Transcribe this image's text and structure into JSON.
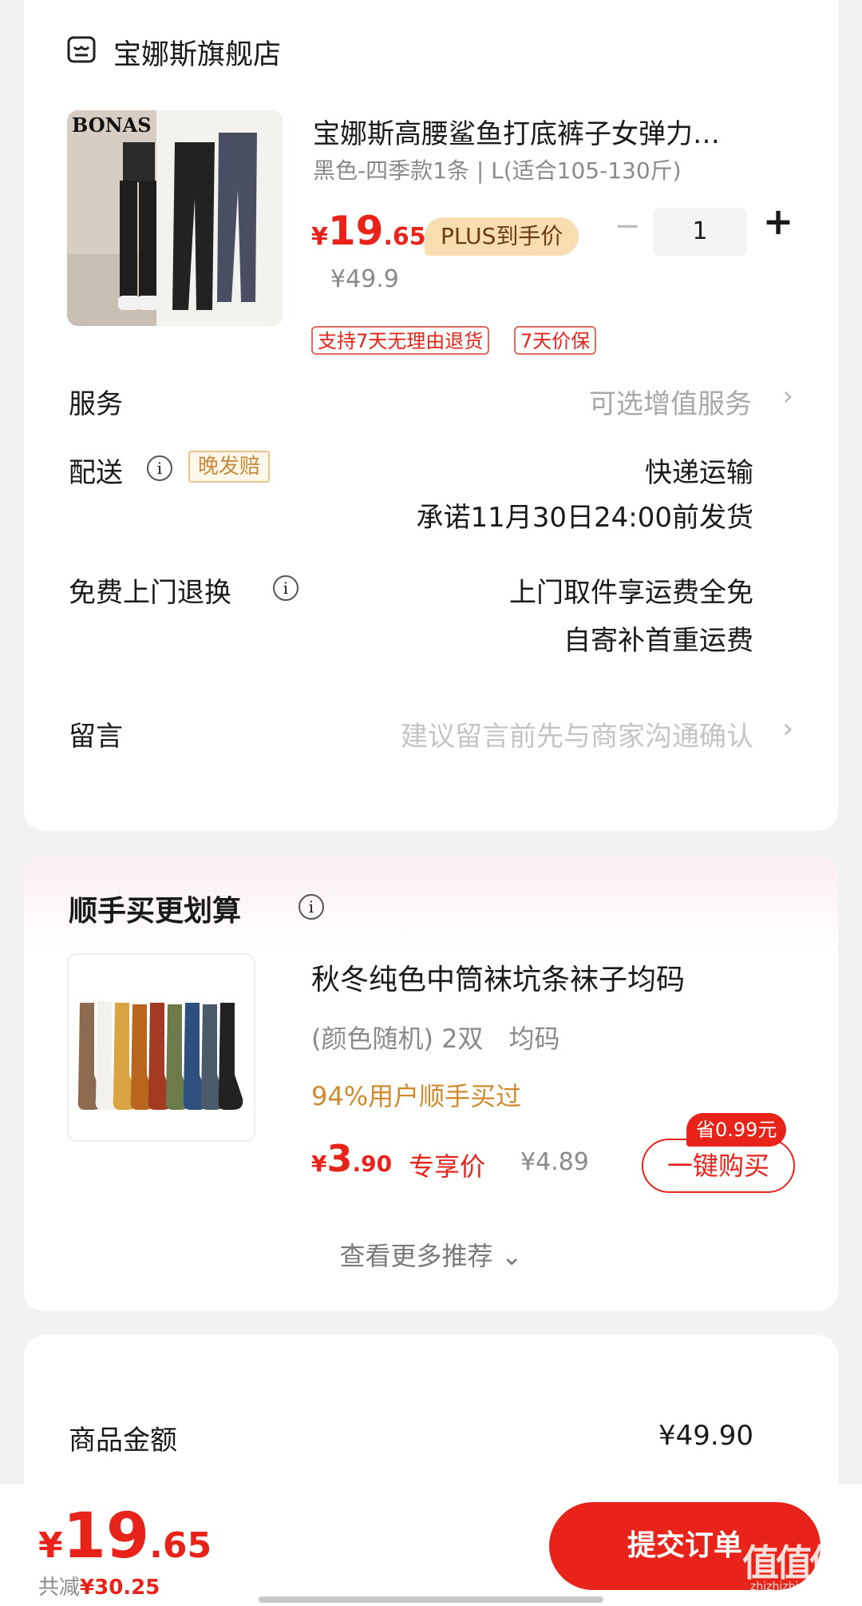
{
  "store": {
    "name": "宝娜斯旗舰店",
    "icon": "store-icon"
  },
  "product": {
    "title": "宝娜斯高腰鲨鱼打底裤子女弹力…",
    "spec": "黑色-四季款1条 | L(适合105-130斤)",
    "price_symbol": "¥",
    "price_int": "19",
    "price_dec": ".65",
    "plus_label": "PLUS到手价",
    "minus_label": "−",
    "quantity": "1",
    "plus_label_btn": "+",
    "original_price": "¥49.9",
    "tags": [
      "支持7天无理由退货",
      "7天价保"
    ],
    "image_brand": "BONAS"
  },
  "rows": {
    "service": {
      "label": "服务",
      "value": "可选增值服务",
      "chevron": "›"
    },
    "delivery": {
      "label": "配送",
      "badge": "晚发赔",
      "value_line1": "快递运输",
      "value_line2": "承诺11月30日24:00前发货"
    },
    "return": {
      "label": "免费上门退换",
      "value_line1": "上门取件享运费全免",
      "value_line2": "自寄补首重运费"
    },
    "message": {
      "label": "留言",
      "placeholder": "建议留言前先与商家沟通确认",
      "chevron": "›"
    }
  },
  "addon": {
    "section_title": "顺手买更划算",
    "title": "秋冬纯色中筒袜坑条袜子均码",
    "spec": "(颜色随机) 2双",
    "size": "均码",
    "hint": "94%用户顺手买过",
    "price_symbol": "¥",
    "price_int": "3",
    "price_dec": ".90",
    "exclusive": "专享价",
    "original_price": "¥4.89",
    "save_badge": "省0.99元",
    "buy_button": "一键购买",
    "more": "查看更多推荐",
    "more_chevron": "⌄"
  },
  "summary": {
    "label": "商品金额",
    "value": "¥49.90"
  },
  "bottom": {
    "price_symbol": "¥",
    "price_int": "19",
    "price_dec": ".65",
    "reduced_label": "共减",
    "reduced_value": "¥30.25",
    "submit": "提交订单"
  },
  "watermark": {
    "main": "值值值",
    "sub": "zhizhizhi.com"
  },
  "colors": {
    "accent": "#e8231a",
    "plus_badge": "#f7ddb0",
    "hint": "#d08a2e"
  }
}
